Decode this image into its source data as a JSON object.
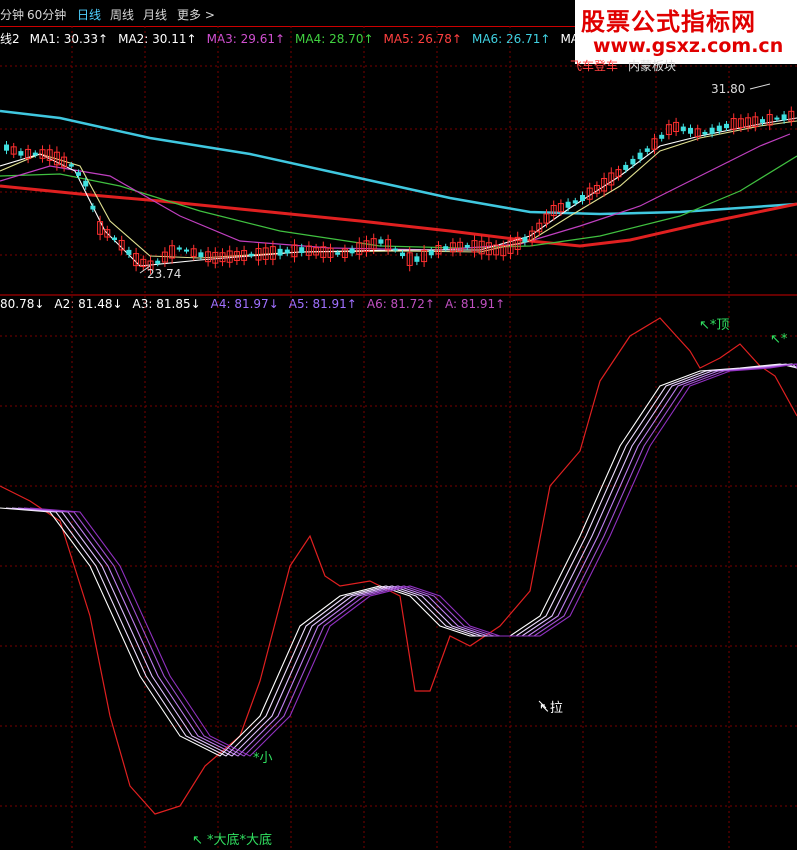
{
  "toolbar": {
    "tabs": [
      "分钟",
      "60分钟",
      "日线",
      "周线",
      "月线",
      "更多 >"
    ],
    "active_tab": "日线"
  },
  "watermark": {
    "title": "股票公式指标网",
    "url": "www.gsxz.com.cn"
  },
  "price_panel": {
    "legend": [
      {
        "label": "线2",
        "value": "",
        "color": "#ffffff"
      },
      {
        "label": "MA1:",
        "value": "30.33↑",
        "color": "#ffffff"
      },
      {
        "label": "MA2:",
        "value": "30.11↑",
        "color": "#ffffff"
      },
      {
        "label": "MA3:",
        "value": "29.61↑",
        "color": "#d050d0"
      },
      {
        "label": "MA4:",
        "value": "28.70↑",
        "color": "#40d040"
      },
      {
        "label": "MA5:",
        "value": "26.78↑",
        "color": "#ff4040"
      },
      {
        "label": "MA6:",
        "value": "26.71↑",
        "color": "#40d0e0"
      },
      {
        "label": "MA",
        "value": "",
        "color": "#ffffff"
      }
    ],
    "high_label": "31.80",
    "low_label": "23.74",
    "note": "内蒙板块",
    "note_prefix": "飞车登车"
  },
  "indicator_panel": {
    "legend": [
      {
        "label": "80.78",
        "arrow": "↓",
        "color": "#ffffff"
      },
      {
        "label": "A2: 81.48",
        "arrow": "↓",
        "color": "#ffffff"
      },
      {
        "label": "A3: 81.85",
        "arrow": "↓",
        "color": "#ffffff"
      },
      {
        "label": "A4: 81.97",
        "arrow": "↓",
        "color": "#a070ff"
      },
      {
        "label": "A5: 81.91",
        "arrow": "↑",
        "color": "#a070ff"
      },
      {
        "label": "A6: 81.72",
        "arrow": "↑",
        "color": "#c050c0"
      },
      {
        "label": "A: 81.91",
        "arrow": "↑",
        "color": "#c050c0"
      }
    ],
    "annotations": {
      "top": "↖*顶",
      "top2": "↖*",
      "pull": "↖拉",
      "small": "*小",
      "bottom": "↖ *大底*大底"
    }
  },
  "colors": {
    "up": "#ff3030",
    "down": "#40e0e0",
    "grid": "#7a0000"
  }
}
